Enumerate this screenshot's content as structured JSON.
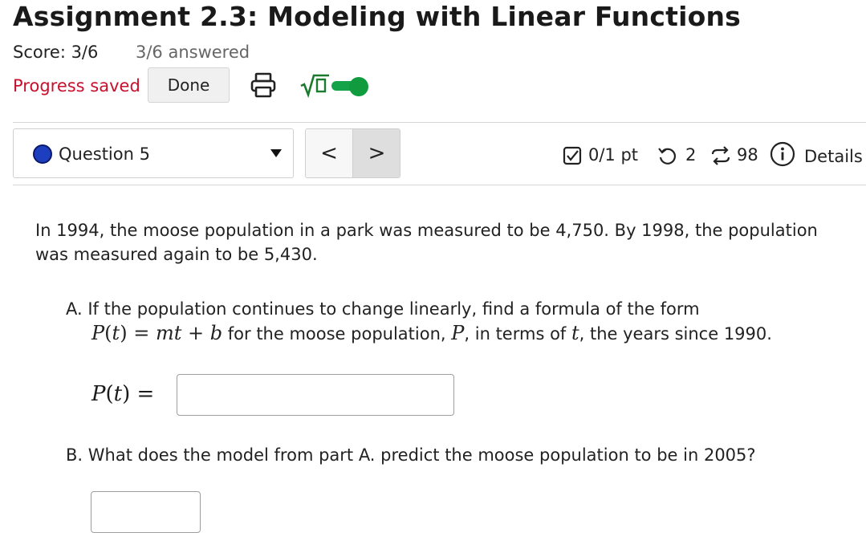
{
  "assignment": {
    "title": "Assignment 2.3: Modeling with Linear Functions",
    "score": "Score: 3/6",
    "answered": "3/6 answered"
  },
  "toolbar": {
    "progress_status": "Progress saved",
    "done_label": "Done",
    "print_icon": "printer-icon",
    "math_icon": "sqrt-icon",
    "math_toggle_on": true,
    "colors": {
      "progress": "#c8102e",
      "toggle": "#15a34a"
    }
  },
  "question_nav": {
    "selected": "Question 5",
    "status_color": "#1d3fbf",
    "prev_label": "<",
    "next_label": ">"
  },
  "question_meta": {
    "points": "0/1 pt",
    "attempts": "2",
    "version": "98",
    "details": "Details"
  },
  "question": {
    "prompt": "In 1994, the moose population in a park was measured to be 4,750. By 1998, the population was measured again to be 5,430.",
    "part_a": {
      "line1": "A. If the population continues to change linearly, find a formula of the form",
      "line2_text1": " for the moose population, ",
      "line2_text2": ", in terms of ",
      "line2_text3": ", the years since 1990.",
      "answer_label": "P(t) =",
      "answer_value": ""
    },
    "part_b": {
      "text": "B. What does the model from part A. predict the moose population to be in 2005?",
      "answer_value": ""
    }
  }
}
